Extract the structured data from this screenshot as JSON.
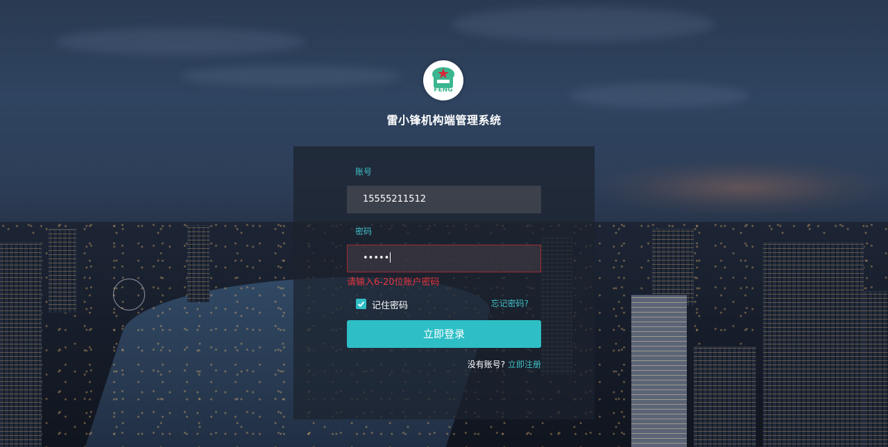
{
  "app": {
    "title": "雷小锋机构端管理系统",
    "logo_text": "FENG"
  },
  "form": {
    "account_label": "账号",
    "account_value": "15555211512",
    "password_label": "密码",
    "password_value": "•••••",
    "password_error": "请输入6-20位账户密码",
    "remember_label": "记住密码",
    "remember_checked": true,
    "forgot_label": "忘记密码?",
    "submit_label": "立即登录",
    "no_account_text": "没有账号?",
    "register_label": "立即注册"
  },
  "colors": {
    "accent": "#2ebfc6",
    "error": "#e8343f",
    "logo_green": "#3bb58f",
    "logo_star": "#d6283a"
  },
  "icons": {
    "checkbox": "check-icon",
    "logo": "feng-logo-icon"
  }
}
